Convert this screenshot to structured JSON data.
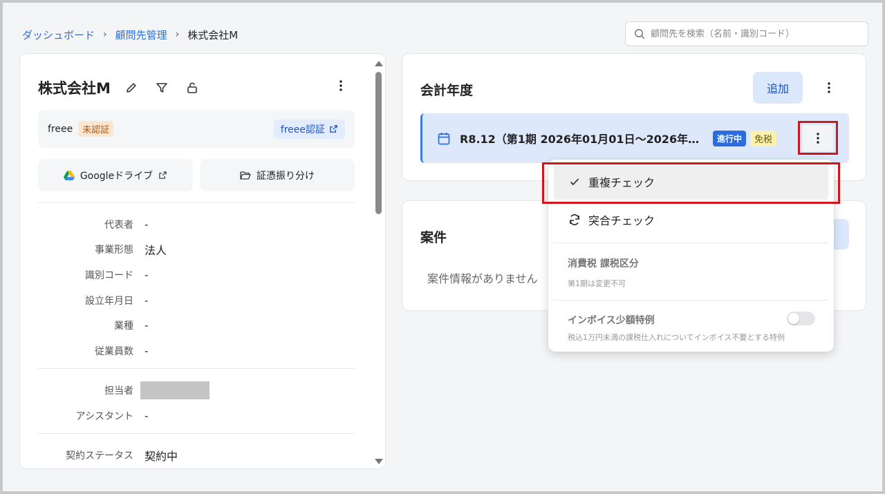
{
  "breadcrumb": {
    "items": [
      "ダッシュボード",
      "顧問先管理"
    ],
    "current": "株式会社M"
  },
  "search": {
    "placeholder": "顧問先を検索（名前・識別コード）"
  },
  "client": {
    "name": "株式会社M",
    "freee": {
      "label": "freee",
      "status": "未認証",
      "auth_button": "freee認証"
    },
    "google_drive_button": "Googleドライブ",
    "voucher_button": "証憑振り分け",
    "fields": [
      {
        "label": "代表者",
        "value": "-"
      },
      {
        "label": "事業形態",
        "value": "法人"
      },
      {
        "label": "識別コード",
        "value": "-"
      },
      {
        "label": "設立年月日",
        "value": "-"
      },
      {
        "label": "業種",
        "value": "-"
      },
      {
        "label": "従業員数",
        "value": "-"
      }
    ],
    "staff": [
      {
        "label": "担当者",
        "value": ""
      },
      {
        "label": "アシスタント",
        "value": "-"
      }
    ],
    "contract": {
      "label": "契約ステータス",
      "value": "契約中"
    }
  },
  "fiscal_year": {
    "title": "会計年度",
    "add_button": "追加",
    "row": {
      "text": "R8.12（第1期 2026年01月01日〜2026年…",
      "status": "進行中",
      "tax": "免税"
    }
  },
  "cases": {
    "title": "案件",
    "empty": "案件情報がありません"
  },
  "menu": {
    "items": [
      {
        "label": "重複チェック",
        "icon": "check-icon"
      },
      {
        "label": "突合チェック",
        "icon": "refresh-icon"
      }
    ],
    "tax_section": {
      "title": "消費税 課税区分",
      "note": "第1期は変更不可"
    },
    "invoice_section": {
      "title": "インボイス少額特例",
      "note": "税込1万円未満の課税仕入れについてインボイス不要とする特例",
      "enabled": false
    }
  },
  "colors": {
    "accent": "#2f6fd6",
    "highlight": "#d0151b",
    "progress_badge": "#2c6be0"
  }
}
